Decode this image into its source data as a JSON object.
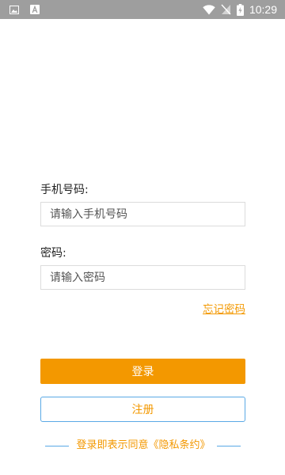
{
  "status_bar": {
    "time": "10:29",
    "icons": [
      "image-icon",
      "a-icon",
      "wifi-icon",
      "no-sim-icon",
      "battery-charging-icon"
    ]
  },
  "login": {
    "phone_label": "手机号码:",
    "phone_placeholder": "请输入手机号码",
    "password_label": "密码:",
    "password_placeholder": "请输入密码",
    "forgot_link": "忘记密码",
    "login_button": "登录",
    "register_button": "注册",
    "agreement_text": "登录即表示同意《隐私条约》"
  },
  "colors": {
    "accent": "#f39800",
    "border_blue": "#5aa9e6",
    "status_bar": "#9e9e9e"
  }
}
